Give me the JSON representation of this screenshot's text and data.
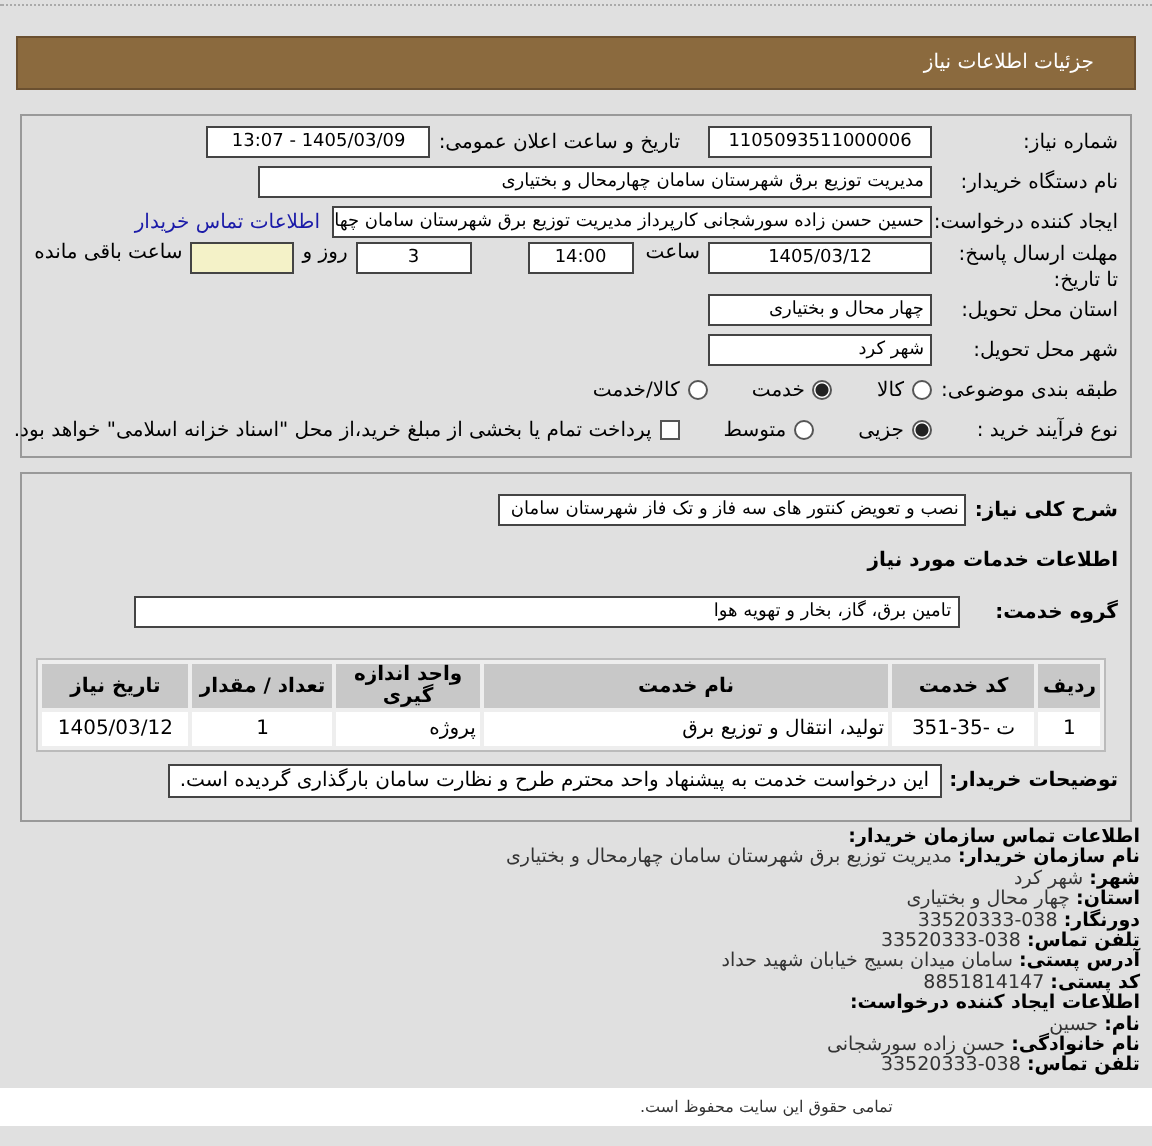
{
  "header": {
    "title": "جزئیات اطلاعات نیاز"
  },
  "details": {
    "need_number": {
      "label": "شماره نیاز:",
      "value": "1105093511000006"
    },
    "announce_datetime": {
      "label": "تاریخ و ساعت اعلان عمومی:",
      "value": "1405/03/09 - 13:07"
    },
    "buyer_org": {
      "label": "نام دستگاه خریدار:",
      "value": "مدیریت توزیع برق شهرستان سامان چهارمحال و بختیاری"
    },
    "requester": {
      "label": "ایجاد کننده درخواست:",
      "value": "حسین حسن زاده سورشجانی کارپرداز مدیریت توزیع برق شهرستان سامان چها",
      "link": "اطلاعات تماس خریدار"
    },
    "deadline": {
      "label": "مهلت ارسال پاسخ: تا تاریخ:",
      "date": "1405/03/12",
      "time_label": "ساعت",
      "time": "14:00",
      "days": "3",
      "days_label": "روز و",
      "remaining_label": "ساعت باقی مانده"
    },
    "province": {
      "label": "استان محل تحویل:",
      "value": "چهار محال و بختیاری"
    },
    "city": {
      "label": "شهر محل تحویل:",
      "value": "شهر کرد"
    },
    "category": {
      "label": "طبقه بندی موضوعی:",
      "options": [
        {
          "label": "کالا",
          "selected": false
        },
        {
          "label": "خدمت",
          "selected": true
        },
        {
          "label": "کالا/خدمت",
          "selected": false
        }
      ]
    },
    "process": {
      "label": "نوع فرآیند خرید :",
      "options": [
        {
          "label": "جزیی",
          "selected": true
        },
        {
          "label": "متوسط",
          "selected": false
        }
      ],
      "treasury": {
        "checked": false,
        "text": "پرداخت تمام یا بخشی از مبلغ خرید،از محل \"اسناد خزانه اسلامی\" خواهد بود."
      }
    }
  },
  "need": {
    "description": {
      "label": "شرح کلی نیاز:",
      "value": "نصب و تعویض کنتور های سه فاز و تک فاز شهرستان سامان"
    },
    "services_title": "اطلاعات خدمات مورد نیاز",
    "service_group": {
      "label": "گروه خدمت:",
      "value": "تامین برق، گاز، بخار و تهویه هوا"
    },
    "table": {
      "columns": [
        "ردیف",
        "کد خدمت",
        "نام خدمت",
        "واحد اندازه گیری",
        "تعداد / مقدار",
        "تاریخ نیاز"
      ],
      "rows": [
        [
          "1",
          "ت -35-351",
          "تولید، انتقال و توزیع برق",
          "پروژه",
          "1",
          "1405/03/12"
        ]
      ]
    },
    "buyer_notes": {
      "label": "توضیحات خریدار:",
      "value": "این درخواست خدمت به پیشنهاد واحد محترم طرح و نظارت سامان بارگذاری گردیده است."
    }
  },
  "contact": {
    "title": "اطلاعات تماس سازمان خریدار:",
    "lines": [
      {
        "label": "نام سازمان خریدار:",
        "value": "مدیریت توزیع برق شهرستان سامان چهارمحال و بختیاری"
      },
      {
        "label": "شهر:",
        "value": "شهر کرد"
      },
      {
        "label": "استان:",
        "value": "چهار محال و بختیاری"
      },
      {
        "label": "دورنگار:",
        "value": "038-33520333"
      },
      {
        "label": "تلفن تماس:",
        "value": "038-33520333"
      },
      {
        "label": "آدرس پستی:",
        "value": "سامان میدان بسیج خیابان شهید حداد"
      },
      {
        "label": "کد پستی:",
        "value": "8851814147"
      }
    ],
    "creator_title": "اطلاعات ایجاد کننده درخواست:",
    "creator_lines": [
      {
        "label": "نام:",
        "value": "حسین"
      },
      {
        "label": "نام خانوادگی:",
        "value": "حسن زاده سورشجانی"
      },
      {
        "label": "تلفن تماس:",
        "value": "038-33520333"
      }
    ]
  },
  "footer": {
    "text": "تمامی حقوق این سایت محفوظ است."
  }
}
